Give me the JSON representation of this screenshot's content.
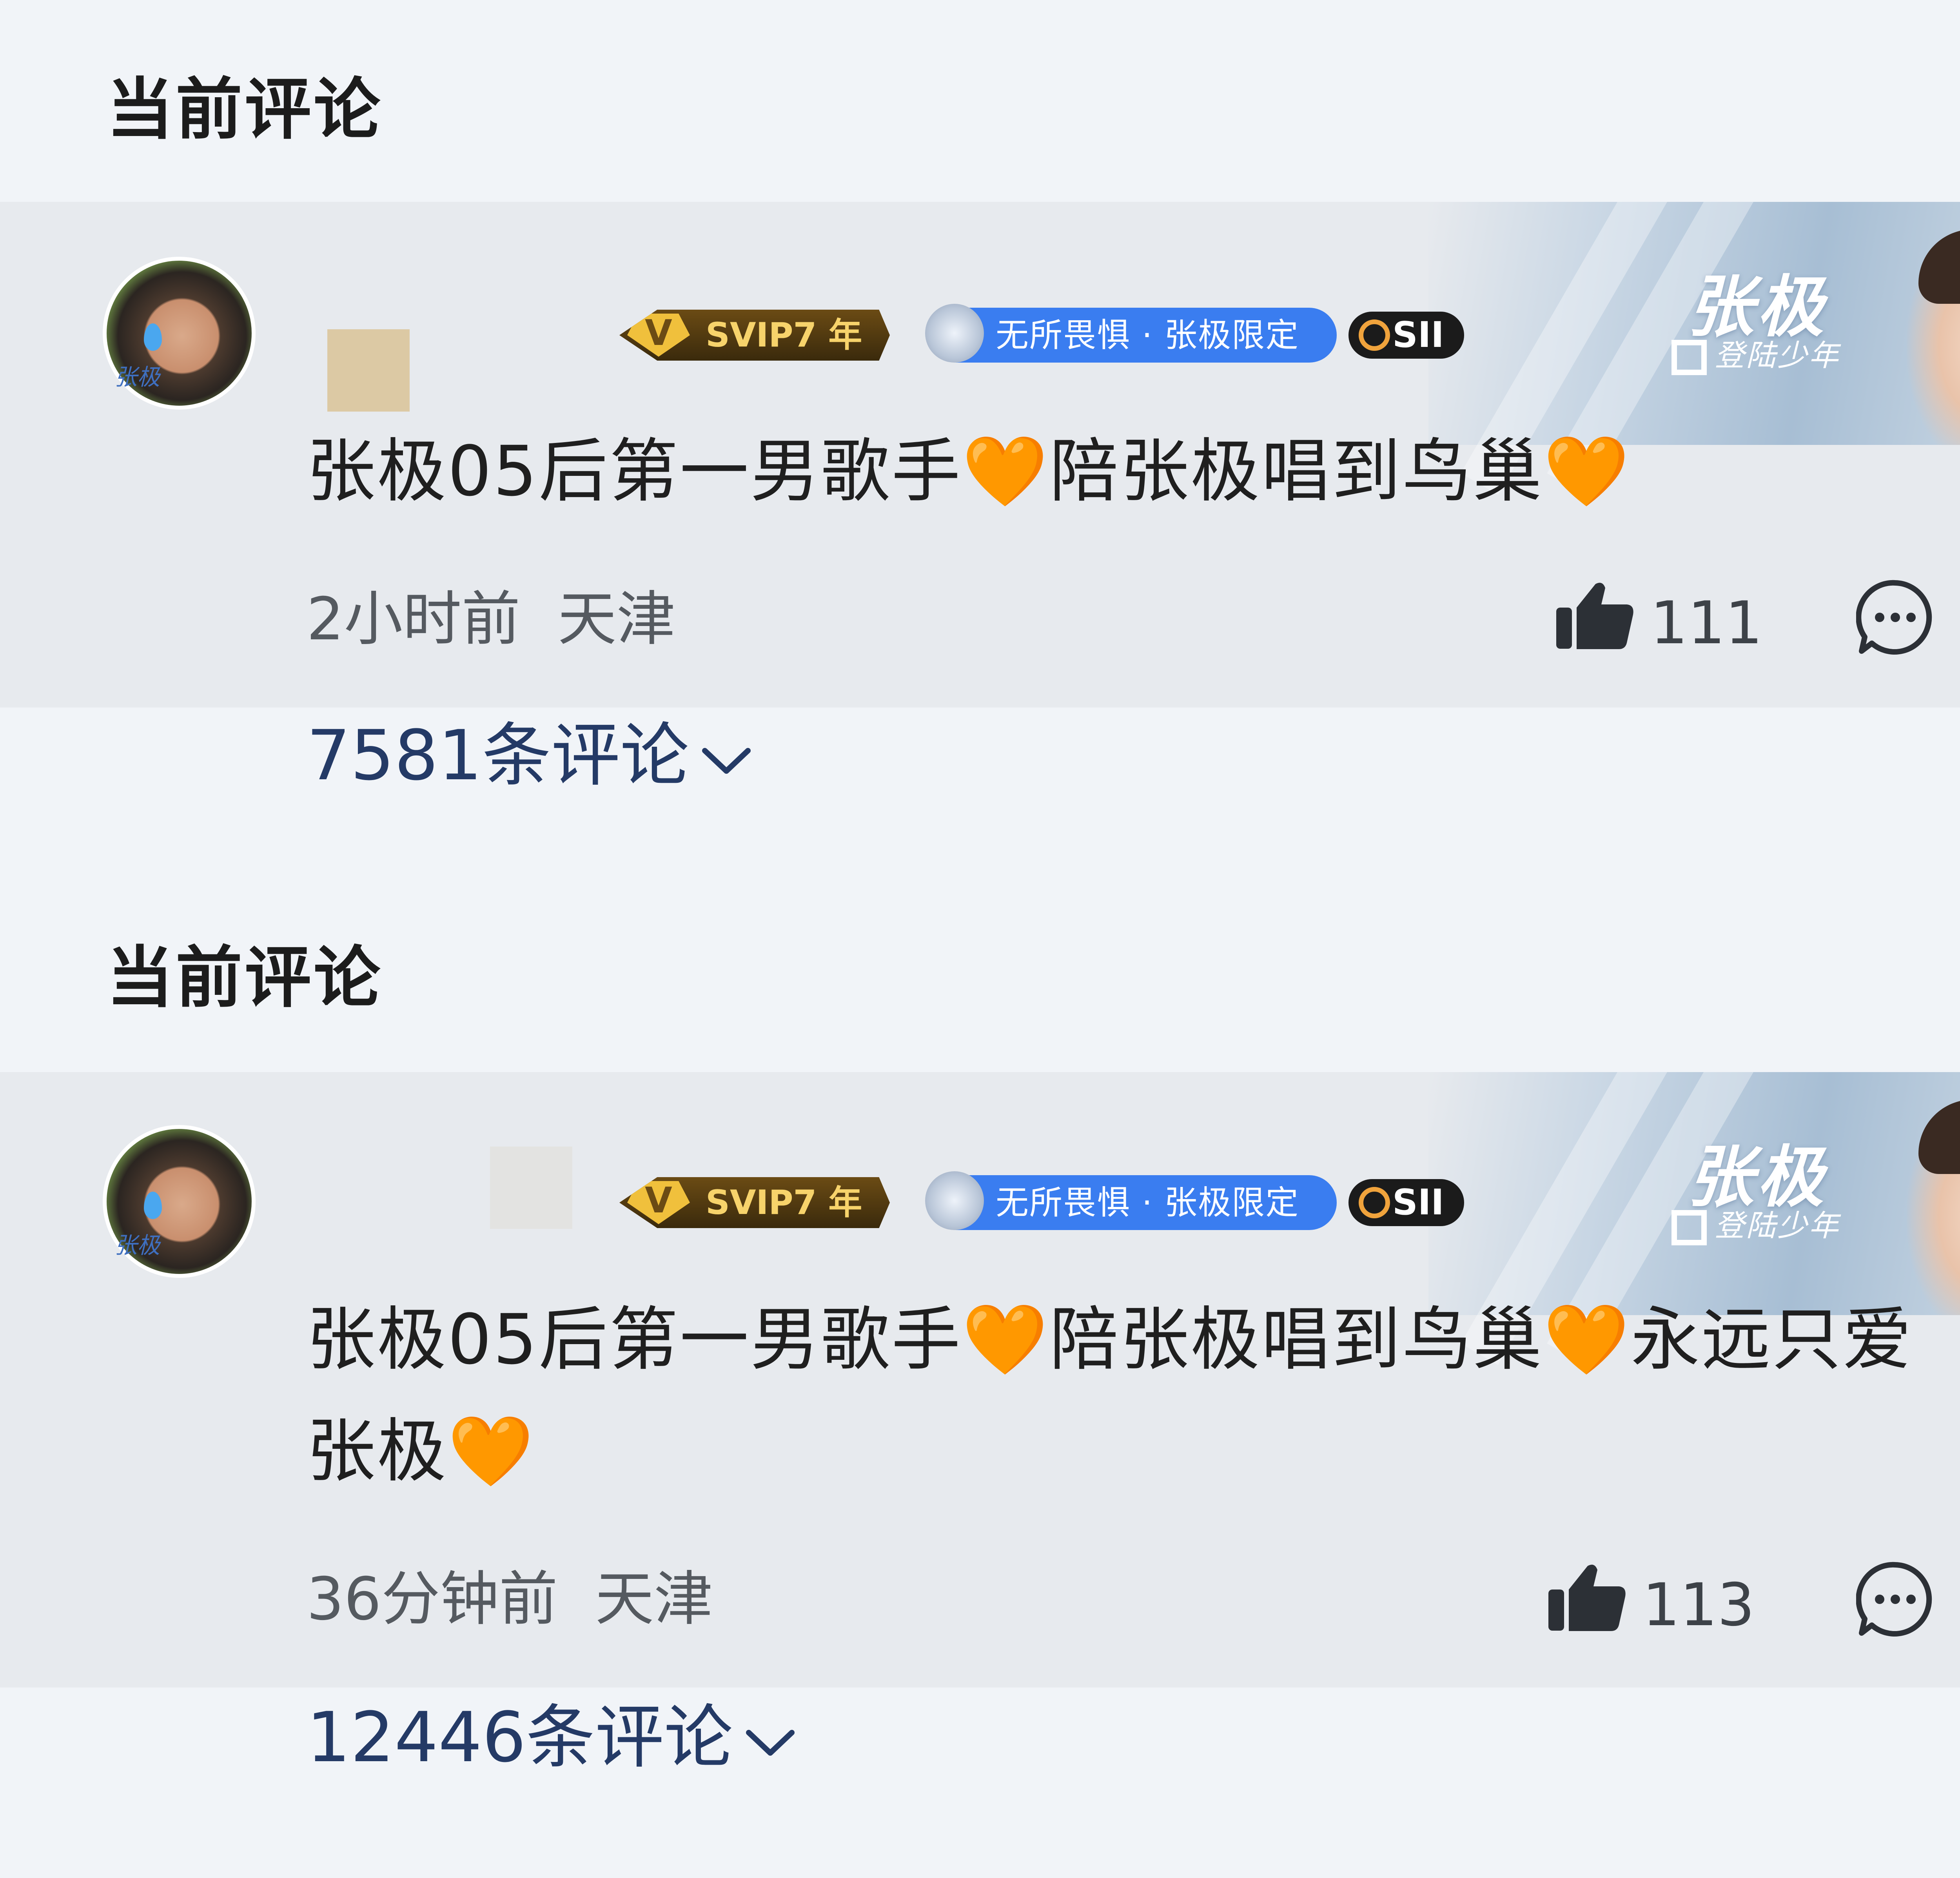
{
  "comments": [
    {
      "section_title": "当前评论",
      "vip_badge": "SVIP7 年",
      "fan_badge": "无所畏惧 · 张极限定",
      "level_badge": "SII",
      "banner_name": "张极",
      "banner_logo": "登陆少年",
      "avatar_label": "张极",
      "text_parts": [
        "张极05后第一男歌手",
        "🧡",
        "陪张极唱到鸟巢",
        "🧡"
      ],
      "time": "2小时前",
      "location": "天津",
      "likes": "111",
      "reply_count_label": "7581条评论"
    },
    {
      "section_title": "当前评论",
      "vip_badge": "SVIP7 年",
      "fan_badge": "无所畏惧 · 张极限定",
      "level_badge": "SII",
      "banner_name": "张极",
      "banner_logo": "登陆少年",
      "avatar_label": "张极",
      "text_parts": [
        "张极05后第一男歌手",
        "🧡",
        "陪张极唱到鸟巢",
        "🧡",
        "永远只爱张极",
        "🧡"
      ],
      "time": "36分钟前",
      "location": "天津",
      "likes": "113",
      "reply_count_label": "12446条评论"
    }
  ],
  "colors": {
    "page_bg": "#f1f4f8",
    "card_bg": "#e7eaee",
    "reply_link": "#243a66",
    "fan_badge": "#3a7df0",
    "heart": "#ff8a1c"
  },
  "icons": [
    "avatar",
    "svip-badge",
    "fan-badge-icon",
    "level-icon",
    "thumbs-up-icon",
    "comment-bubble-icon",
    "chevron-down-icon"
  ]
}
